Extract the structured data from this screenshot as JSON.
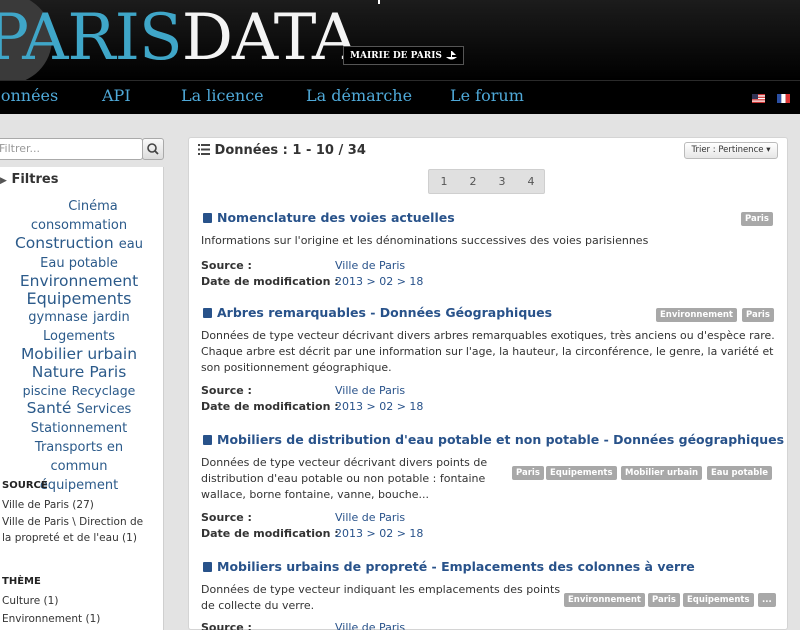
{
  "header": {
    "logo_part1": "PARIS",
    "logo_part2": "DATA",
    "mairie": "MAIRIE DE PARIS"
  },
  "nav": {
    "items": [
      "Données",
      "API",
      "La licence",
      "La démarche",
      "Le forum"
    ],
    "flags": [
      "us-flag-icon",
      "fr-flag-icon"
    ]
  },
  "sidebar": {
    "search_placeholder": "Filtrer...",
    "filtres_label": "Filtres",
    "cloud": [
      "Cinéma",
      "consommation",
      "Construction",
      "eau",
      "Eau potable",
      "Environnement",
      "Equipements",
      "gymnase",
      "jardin",
      "Logements",
      "Mobilier urbain",
      "Nature",
      "Paris",
      "piscine",
      "Recyclage",
      "Santé",
      "Services",
      "Stationnement",
      "Transports en commun",
      "équipement"
    ],
    "source_heading": "SOURCE",
    "source_items": [
      "Ville de Paris (27)",
      "Ville de Paris \\ Direction de la propreté et de l'eau (1)"
    ],
    "theme_heading": "THÈME",
    "theme_items": [
      "Culture (1)",
      "Environnement (1)"
    ]
  },
  "main": {
    "title": "Données : 1 - 10 / 34",
    "sort_label": "Trier : Pertinence",
    "pages": [
      "1",
      "2",
      "3",
      "4"
    ],
    "source_label": "Source :",
    "date_label": "Date de modification :",
    "datasets": [
      {
        "title": "Nomenclature des voies actuelles",
        "desc": "Informations sur l'origine et les dénominations successives des voies parisiennes",
        "source": "Ville de Paris",
        "date": "2013 > 02 > 18",
        "tags": [
          "Paris"
        ]
      },
      {
        "title": "Arbres remarquables - Données Géographiques",
        "desc": "Données de type vecteur décrivant divers arbres remarquables exotiques, très anciens ou d'espèce rare. Chaque arbre est décrit par une information sur l'age, la hauteur, la circonférence, le genre, la variété et son positionnement géographique.",
        "source": "Ville de Paris",
        "date": "2013 > 02 > 18",
        "tags": [
          "Environnement",
          "Paris"
        ]
      },
      {
        "title": "Mobiliers de distribution d'eau potable et non potable - Données géographiques",
        "desc": "Données de type vecteur décrivant divers points de distribution d'eau potable ou non potable : fontaine wallace, borne fontaine, vanne, bouche...",
        "source": "Ville de Paris",
        "date": "2013 > 02 > 18",
        "tags": [
          "Paris",
          "Equipements",
          "Mobilier urbain",
          "Eau potable"
        ]
      },
      {
        "title": "Mobiliers urbains de propreté - Emplacements des colonnes à verre",
        "desc": "Données de type vecteur indiquant les emplacements des points de collecte du verre.",
        "source": "Ville de Paris",
        "tags": [
          "Environnement",
          "Paris",
          "Equipements",
          "..."
        ]
      }
    ]
  }
}
